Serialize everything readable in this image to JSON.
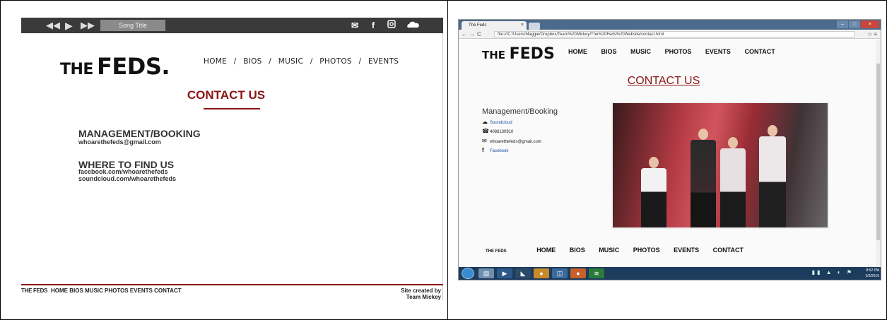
{
  "left": {
    "player": {
      "song_title": "Song Title",
      "prev_glyph": "◀◀",
      "play_glyph": "▶",
      "next_glyph": "▶▶"
    },
    "social": {
      "mail_icon": "mail-icon",
      "facebook_icon": "f",
      "instagram_icon": "instagram-icon",
      "soundcloud_icon": "soundcloud-icon"
    },
    "logo": {
      "the": "THE",
      "feds": "FEDS."
    },
    "nav": [
      "HOME",
      "BIOS",
      "MUSIC",
      "PHOTOS",
      "EVENTS"
    ],
    "nav_sep": "/",
    "title": "CONTACT US",
    "sections": [
      {
        "heading": "MANAGEMENT/BOOKING",
        "lines": [
          "whoarethefeds@gmail.com"
        ]
      },
      {
        "heading": "WHERE TO FIND US",
        "lines": [
          "facebook.com/whoarethefeds",
          "soundcloud.com/whoarethefeds"
        ]
      }
    ],
    "footer": {
      "logo": "THE FEDS",
      "nav": "HOME  BIOS  MUSIC  PHOTOS EVENTS CONTACT",
      "credit_line1": "Site created by",
      "credit_line2": "Team Mickey"
    }
  },
  "right": {
    "tab_title": "The Feds",
    "tab_close": "×",
    "url": "file:///C:/Users/Maggie/Dropbox/Team%20Mickey/The%20Feds%20Website/contact.html",
    "logo": {
      "the": "THE",
      "feds": "FEDS"
    },
    "nav": [
      "HOME",
      "BIOS",
      "MUSIC",
      "PHOTOS",
      "EVENTS",
      "CONTACT"
    ],
    "title": "CONTACT US",
    "management_heading": "Management/Booking",
    "contacts": [
      {
        "icon": "cloud-icon",
        "glyph": "☁",
        "text": "Soundcloud",
        "link": true
      },
      {
        "icon": "phone-icon",
        "glyph": "☎",
        "text": "4086130910",
        "link": false
      },
      {
        "icon": "mail-icon",
        "glyph": "✉",
        "text": "whoarethefeds@gmail.com",
        "link": false
      },
      {
        "icon": "facebook-icon",
        "glyph": "f",
        "text": "Facebook",
        "link": true
      }
    ],
    "footer": {
      "logo": "THE FEDS",
      "nav": [
        "HOME",
        "BIOS",
        "MUSIC",
        "PHOTOS",
        "EVENTS",
        "CONTACT"
      ]
    },
    "clock": {
      "time": "8:52 PM",
      "date": "3/3/2015"
    }
  }
}
